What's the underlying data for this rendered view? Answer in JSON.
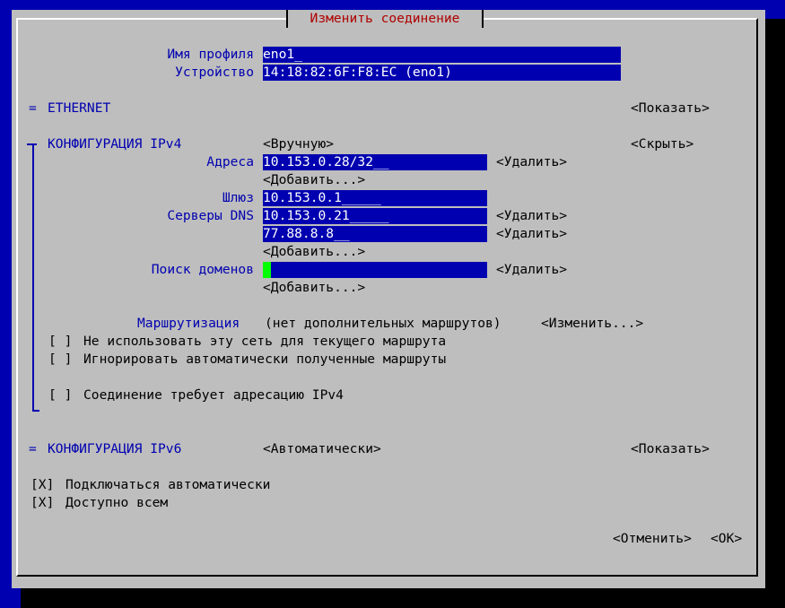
{
  "dialog": {
    "title": "Изменить соединение"
  },
  "profile": {
    "name_label": "Имя профиля",
    "name_value": "eno1",
    "device_label": "Устройство",
    "device_value": "14:18:82:6F:F8:EC (eno1)"
  },
  "ethernet": {
    "label": "ETHERNET",
    "toggle": "<Показать>"
  },
  "ipv4": {
    "label": "КОНФИГУРАЦИЯ IPv4",
    "mode": "<Вручную>",
    "toggle": "<Скрыть>",
    "addresses_label": "Адреса",
    "addresses": [
      "10.153.0.28/32"
    ],
    "gateway_label": "Шлюз",
    "gateway": "10.153.0.1",
    "dns_label": "Серверы DNS",
    "dns": [
      "10.153.0.21",
      "77.88.8.8"
    ],
    "search_label": "Поиск доменов",
    "search_value": "",
    "remove_label": "<Удалить>",
    "add_label": "<Добавить...>",
    "routing_label": "Маршрутизация",
    "routing_value": "(нет дополнительных маршрутов)",
    "routing_edit": "<Изменить...>",
    "never_default": {
      "mark": "[ ]",
      "label": "Не использовать эту сеть для текущего маршрута"
    },
    "ignore_routes": {
      "mark": "[ ]",
      "label": "Игнорировать автоматически полученные маршруты"
    },
    "require_ipv4": {
      "mark": "[ ]",
      "label": "Соединение требует адресацию IPv4"
    }
  },
  "ipv6": {
    "label": "КОНФИГУРАЦИЯ IPv6",
    "mode": "<Автоматически>",
    "toggle": "<Показать>"
  },
  "autoconnect": {
    "mark": "[X]",
    "label": "Подключаться автоматически"
  },
  "all_users": {
    "mark": "[X]",
    "label": "Доступно всем"
  },
  "buttons": {
    "cancel": "<Отменить>",
    "ok": "<OK>"
  },
  "colors": {
    "background": "#0000b0",
    "dialog": "#bebebe",
    "field": "#0000b0",
    "title": "#b00000",
    "cursor": "#00ff00"
  }
}
